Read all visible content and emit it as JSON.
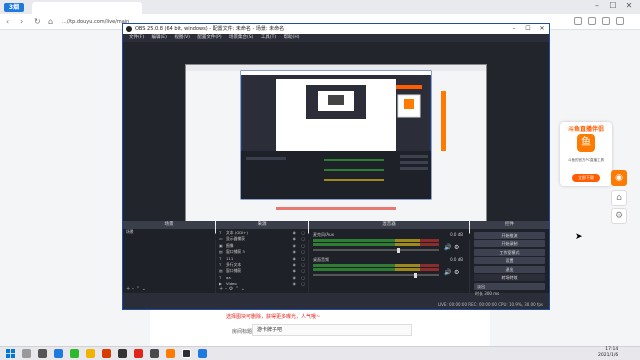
{
  "browser": {
    "logo": "3烟",
    "url": "...//tp.douyu.com/live/main",
    "tab_title": ""
  },
  "webpage": {
    "upload_tip": "选择图块可删除，获得更多曝光，人气哦~",
    "title_label": "房间标题",
    "title_value": "游卡牌子吧"
  },
  "live_widget": {
    "title": "斗鱼直播伴侣",
    "logo": "鱼",
    "description": "斗鱼的官方PC直播工具",
    "button": "立即下载"
  },
  "obs": {
    "title": "OBS 25.0.8 (64 bit, windows) - 配置文件: 未命名 - 场景: 未命名",
    "menu": [
      "文件(F)",
      "编辑(E)",
      "视图(V)",
      "配置文件(P)",
      "场景集合(S)",
      "工具(T)",
      "帮助(H)"
    ],
    "panels": {
      "scenes": "场景",
      "sources": "来源",
      "mixer": "混音器",
      "controls": "控件"
    },
    "scenes": [
      "场景"
    ],
    "sources": [
      {
        "name": "文本 (GDI+)",
        "icon": "text-icon"
      },
      {
        "name": "显示器捕获",
        "icon": "monitor-icon"
      },
      {
        "name": "图像",
        "icon": "image-icon"
      },
      {
        "name": "窗口捕获 3",
        "icon": "window-icon"
      },
      {
        "name": "111",
        "icon": "text-icon"
      },
      {
        "name": "多行文本",
        "icon": "text-icon"
      },
      {
        "name": "窗口捕获",
        "icon": "window-icon"
      },
      {
        "name": "aa",
        "icon": "text-icon"
      },
      {
        "name": "Video",
        "icon": "video-icon"
      },
      {
        "name": "cvd",
        "icon": "video-icon"
      }
    ],
    "mixer": [
      {
        "name": "麦克风/Aux",
        "db": "0.0 dB",
        "level": 0.68
      },
      {
        "name": "桌面音频",
        "db": "0.0 dB",
        "level": 0.82
      }
    ],
    "controls": [
      "开始推流",
      "开始录制",
      "工作室模式",
      "设置",
      "退出"
    ],
    "transition": {
      "label": "转场特效",
      "value": "淡出",
      "duration_label": "时长",
      "duration": "300 ms"
    },
    "status": "LIVE: 00:00:00   REC: 00:00:00   CPU: 10.9%, 30.00 fps"
  },
  "taskbar": {
    "time": "17:14",
    "date": "2021/1/6"
  },
  "colors": {
    "obs_border": "#1f4ea0",
    "accent_red": "#e2231a",
    "douyu_orange": "#ff5d00"
  }
}
